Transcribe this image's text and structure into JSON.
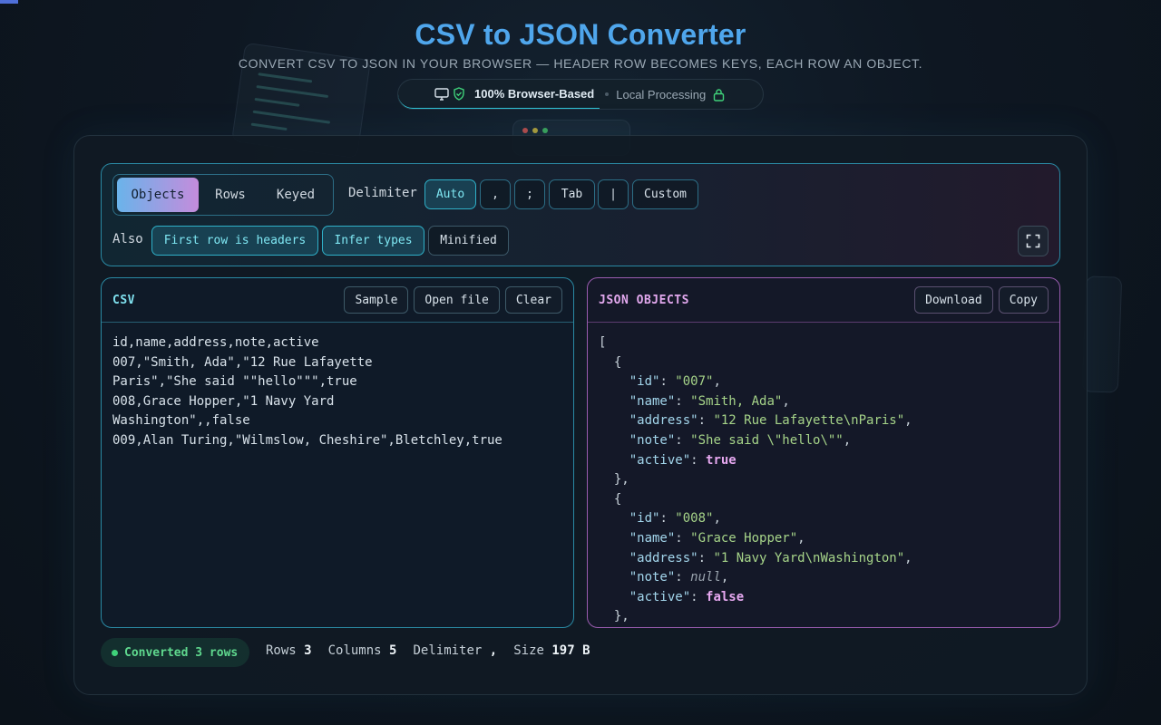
{
  "header": {
    "title": "CSV to JSON Converter",
    "subtitle": "CONVERT CSV TO JSON IN YOUR BROWSER — HEADER ROW BECOMES KEYS, EACH ROW AN OBJECT.",
    "badge_primary": "100% Browser-Based",
    "badge_secondary": "Local Processing"
  },
  "toolbar": {
    "modes": [
      "Objects",
      "Rows",
      "Keyed"
    ],
    "active_mode": "Objects",
    "delimiter_label": "Delimiter",
    "delimiters": [
      "Auto",
      ",",
      ";",
      "Tab",
      "|",
      "Custom"
    ],
    "active_delimiter": "Auto",
    "also_label": "Also",
    "options": [
      {
        "label": "First row is headers",
        "on": true
      },
      {
        "label": "Infer types",
        "on": true
      },
      {
        "label": "Minified",
        "on": false
      }
    ]
  },
  "csv_panel": {
    "title": "CSV",
    "buttons": [
      "Sample",
      "Open file",
      "Clear"
    ],
    "content": "id,name,address,note,active\n007,\"Smith, Ada\",\"12 Rue Lafayette\nParis\",\"She said \"\"hello\"\"\",true\n008,Grace Hopper,\"1 Navy Yard\nWashington\",,false\n009,Alan Turing,\"Wilmslow, Cheshire\",Bletchley,true"
  },
  "json_panel": {
    "title": "JSON OBJECTS",
    "buttons": [
      "Download",
      "Copy"
    ],
    "records": [
      {
        "id": "007",
        "name": "Smith, Ada",
        "address": "12 Rue Lafayette\\nParis",
        "note": "She said \\\"hello\\\"",
        "active": "true"
      },
      {
        "id": "008",
        "name": "Grace Hopper",
        "address": "1 Navy Yard\\nWashington",
        "note": null,
        "active": "false"
      }
    ]
  },
  "status": {
    "message": "Converted 3 rows",
    "rows_label": "Rows",
    "rows_value": "3",
    "columns_label": "Columns",
    "columns_value": "5",
    "delimiter_label": "Delimiter",
    "delimiter_value": ",",
    "size_label": "Size",
    "size_value": "197 B"
  },
  "colors": {
    "title": "#4fa6ec",
    "accent_cyan": "#2fb0c8",
    "accent_purple": "#9a5cb0",
    "success": "#3fd27a"
  }
}
